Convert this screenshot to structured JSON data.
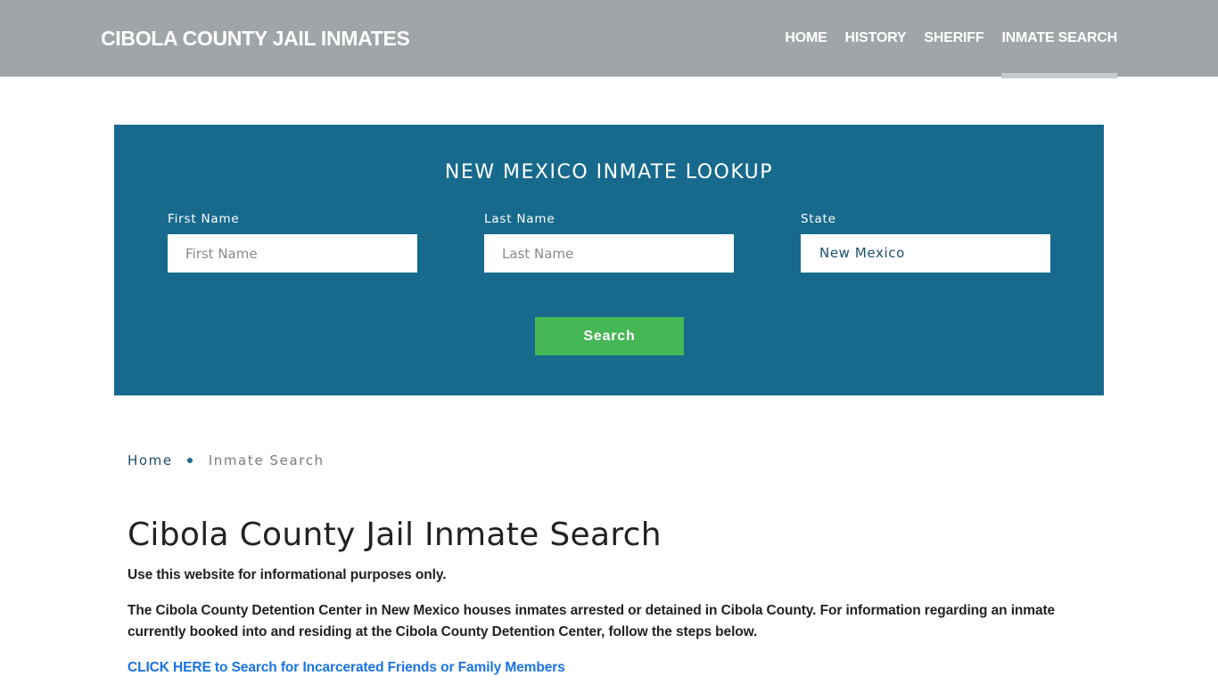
{
  "header": {
    "site_title": "CIBOLA COUNTY JAIL INMATES",
    "nav": [
      {
        "label": "HOME"
      },
      {
        "label": "HISTORY"
      },
      {
        "label": "SHERIFF"
      },
      {
        "label": "INMATE SEARCH",
        "active": true
      }
    ]
  },
  "search_panel": {
    "title": "NEW MEXICO INMATE LOOKUP",
    "first_name": {
      "label": "First Name",
      "placeholder": "First Name",
      "value": ""
    },
    "last_name": {
      "label": "Last Name",
      "placeholder": "Last Name",
      "value": ""
    },
    "state": {
      "label": "State",
      "value": "New Mexico"
    },
    "button_label": "Search"
  },
  "breadcrumb": {
    "home": "Home",
    "current": "Inmate Search"
  },
  "content": {
    "title": "Cibola County Jail Inmate Search",
    "paragraph_1": "Use this website for informational purposes only.",
    "paragraph_2": "The Cibola County Detention Center in New Mexico houses inmates arrested or detained in Cibola County. For information regarding an inmate currently booked into and residing at the Cibola County Detention Center, follow the steps below.",
    "cta_link": "CLICK HERE to Search for Incarcerated Friends or Family Members"
  },
  "colors": {
    "header_bg": "#a0a5a8",
    "panel_bg": "#186a8d",
    "button_bg": "#45b755",
    "link": "#1a73e8"
  }
}
